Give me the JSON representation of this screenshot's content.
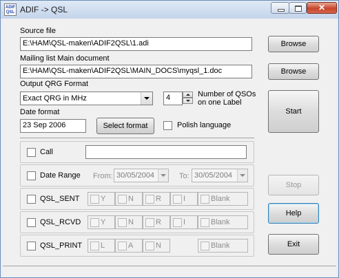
{
  "window": {
    "title": "ADIF -> QSL",
    "icon_text": "ADIF QSL"
  },
  "titlebar_buttons": [
    "minimize",
    "maximize",
    "close"
  ],
  "source_file": {
    "label": "Source file",
    "value": "E:\\HAM\\QSL-maken\\ADIF2QSL\\1.adi",
    "browse_label": "Browse"
  },
  "mailing": {
    "label": "Mailing list Main document",
    "value": "E:\\HAM\\QSL-maken\\ADIF2QSL\\MAIN_DOCS\\myqsl_1.doc",
    "browse_label": "Browse"
  },
  "qrg": {
    "label": "Output QRG Format",
    "value": "Exact QRG in MHz"
  },
  "qsos": {
    "value": "4",
    "label_line1": "Number of QSOs",
    "label_line2": "on one Label"
  },
  "date_format": {
    "label": "Date format",
    "value": "23 Sep 2006",
    "select_label": "Select format"
  },
  "polish": {
    "label": "Polish language",
    "checked": false
  },
  "start_label": "Start",
  "call": {
    "label": "Call",
    "value": "",
    "checked": false
  },
  "date_range": {
    "label": "Date Range",
    "from_label": "From:",
    "from_value": "30/05/2004",
    "to_label": "To:",
    "to_value": "30/05/2004",
    "checked": false
  },
  "qsl_sent": {
    "label": "QSL_SENT",
    "options": [
      "Y",
      "N",
      "R",
      "I",
      "Blank"
    ]
  },
  "qsl_rcvd": {
    "label": "QSL_RCVD",
    "options": [
      "Y",
      "N",
      "R",
      "I",
      "Blank"
    ]
  },
  "qsl_print": {
    "label": "QSL_PRINT",
    "options": [
      "L",
      "A",
      "N",
      "Blank"
    ]
  },
  "buttons": {
    "stop": "Stop",
    "help": "Help",
    "exit": "Exit"
  }
}
